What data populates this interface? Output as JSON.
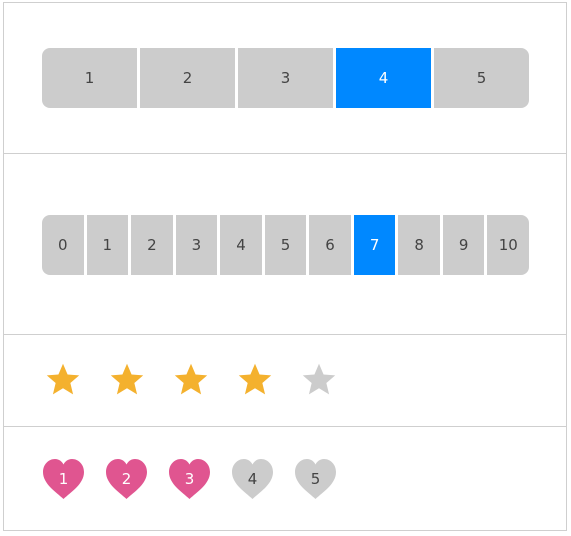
{
  "colors": {
    "active": "#0088ff",
    "inactive": "#cccccc",
    "star_filled": "#f4b12e",
    "star_empty": "#cccccc",
    "heart_filled": "#e05590",
    "heart_empty": "#cccccc"
  },
  "scale_five": {
    "options": [
      "1",
      "2",
      "3",
      "4",
      "5"
    ],
    "selected": "4"
  },
  "scale_eleven": {
    "options": [
      "0",
      "1",
      "2",
      "3",
      "4",
      "5",
      "6",
      "7",
      "8",
      "9",
      "10"
    ],
    "selected": "7"
  },
  "star_rating": {
    "icon": "star-icon",
    "max": 5,
    "value": 4
  },
  "heart_rating": {
    "icon": "heart-icon",
    "labels": [
      "1",
      "2",
      "3",
      "4",
      "5"
    ],
    "value": 3
  }
}
